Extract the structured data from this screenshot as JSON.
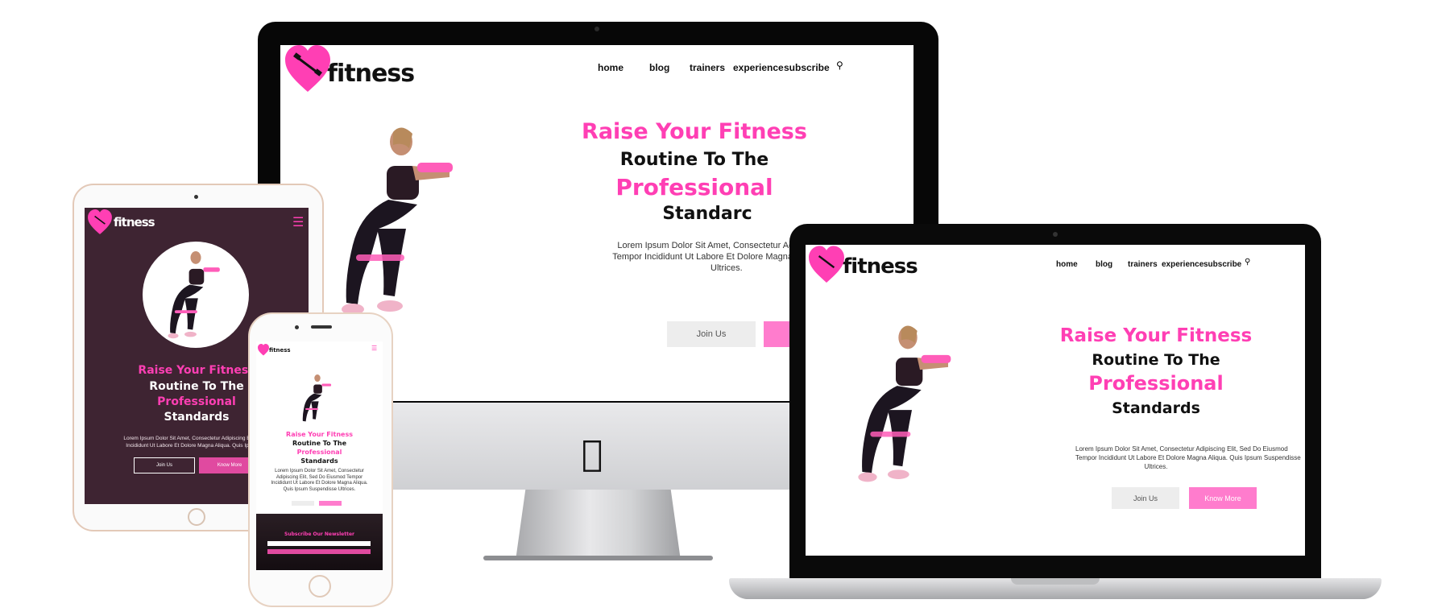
{
  "brand": {
    "name": "fitness",
    "accent": "#ff3fb4",
    "dark_bg": "#3e2432"
  },
  "nav": {
    "home": "home",
    "blog": "blog",
    "trainers": "trainers",
    "experience": "experience",
    "subscribe": "subscribe",
    "search_icon": "search-icon",
    "menu_icon": "hamburger-icon"
  },
  "hero": {
    "line1": "Raise Your Fitness",
    "line2": "Routine To The",
    "line3": "Professional",
    "line4": "Standards",
    "imac_line4": "Standarc",
    "paragraph": "Lorem Ipsum Dolor Sit Amet, Consectetur Adipiscing Elit, Sed Do Eiusmod Tempor Incididunt Ut Labore Et Dolore Magna Aliqua. Quis Ipsum Suspendisse Ultrices.",
    "imac_p1": "Lorem Ipsum Dolor Sit Amet, Consectetur Adi",
    "imac_p2": "Tempor Incididunt Ut Labore Et Dolore Magna A",
    "imac_p3": "Ultrices.",
    "lap_p1": "Lorem Ipsum Dolor Sit Amet, Consectetur Adipiscing Elit, Sed Do Eiusmod",
    "lap_p2": "Tempor Incididunt Ut Labore Et Dolore Magna Aliqua. Quis Ipsum Suspendisse",
    "lap_p3": "Ultrices.",
    "tab_p1": "Lorem Ipsum Dolor Sit Amet, Consectetur Adipiscing Elit, Sed Do",
    "tab_p2": "Incididunt Ut Labore Et Dolore Magna Aliqua. Quis Ipsum Susp",
    "ph_p1": "Lorem Ipsum Dolor Sit Amet, Consectetur",
    "ph_p2": "Adipiscing Elit, Sed Do Eiusmod Tempor",
    "ph_p3": "Incididunt Ut Labore Et Dolore Magna Aliqua.",
    "ph_p4": "Quis Ipsum Suspendisse Ultrices.",
    "join": "Join Us",
    "know": "Know More"
  },
  "newsletter": {
    "title": "Subscribe Our Newsletter"
  }
}
